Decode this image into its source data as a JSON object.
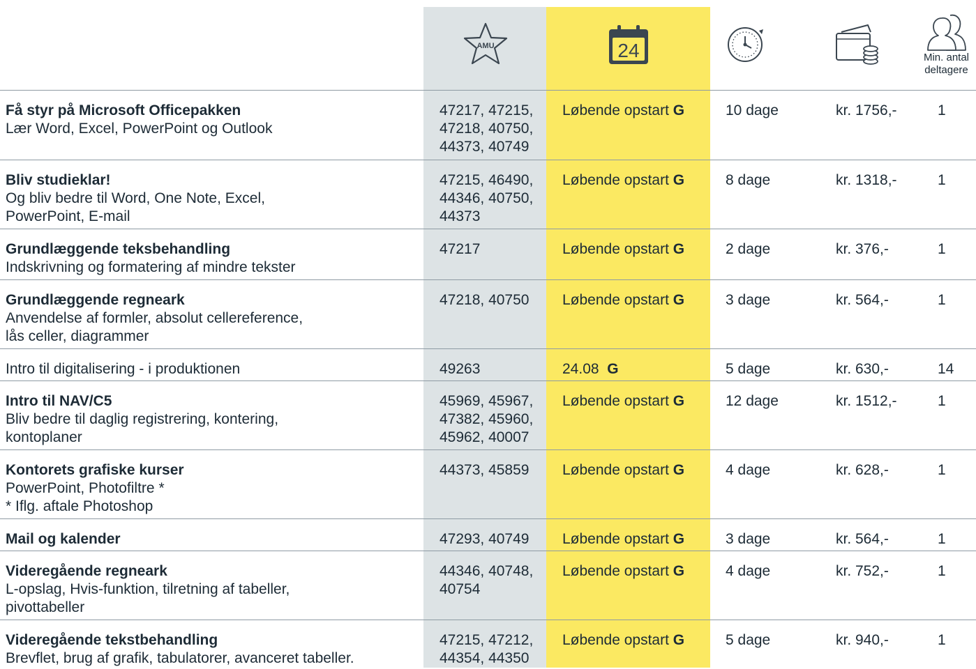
{
  "header": {
    "amu_icon_text": "AMU",
    "calendar_icon_text": "24",
    "min_label_line1": "Min. antal",
    "min_label_line2": "deltagere",
    "icons": [
      "amu-star-icon",
      "calendar-icon",
      "clock-icon",
      "money-icon",
      "people-icon"
    ]
  },
  "colors": {
    "amu_column": "#dde3e5",
    "start_column": "#fbe962",
    "icon": "#3b4650",
    "text": "#1d2b36",
    "divider": "#8e9aa3"
  },
  "rows": [
    {
      "title": "Få styr på Microsoft Officepakken",
      "subtitle_lines": [
        "Lær Word, Excel, PowerPoint og Outlook"
      ],
      "amu_lines": [
        "47217, 47215,",
        "47218, 40750,",
        "44373, 40749"
      ],
      "start": "Løbende opstart",
      "start_flag": "G",
      "duration": "10 dage",
      "price": "kr. 1756,-",
      "min": "1"
    },
    {
      "title": "Bliv studieklar!",
      "subtitle_lines": [
        "Og bliv bedre til Word, One Note, Excel,",
        "PowerPoint, E-mail"
      ],
      "amu_lines": [
        "47215, 46490,",
        "44346, 40750,",
        "44373"
      ],
      "start": "Løbende opstart",
      "start_flag": "G",
      "duration": "8 dage",
      "price": "kr. 1318,-",
      "min": "1"
    },
    {
      "title": "Grundlæggende teksbehandling",
      "subtitle_lines": [
        "Indskrivning og formatering af mindre tekster"
      ],
      "amu_lines": [
        "47217"
      ],
      "start": "Løbende opstart",
      "start_flag": "G",
      "duration": "2 dage",
      "price": "kr. 376,-",
      "min": "1"
    },
    {
      "title": "Grundlæggende regneark",
      "subtitle_lines": [
        "Anvendelse af formler, absolut cellereference,",
        "lås celler, diagrammer"
      ],
      "amu_lines": [
        "47218, 40750"
      ],
      "start": "Løbende opstart",
      "start_flag": "G",
      "duration": "3 dage",
      "price": "kr. 564,-",
      "min": "1"
    },
    {
      "title": "",
      "subtitle_lines": [
        "Intro til digitalisering - i produktionen"
      ],
      "amu_lines": [
        "49263"
      ],
      "start": "24.08 ",
      "start_flag": "G",
      "duration": "5 dage",
      "price": "kr. 630,-",
      "min": "14"
    },
    {
      "title": "Intro til NAV/C5",
      "subtitle_lines": [
        "Bliv bedre til daglig registrering, kontering,",
        "kontoplaner"
      ],
      "amu_lines": [
        "45969, 45967,",
        "47382, 45960,",
        "45962, 40007"
      ],
      "start": "Løbende opstart",
      "start_flag": "G",
      "duration": "12 dage",
      "price": "kr. 1512,-",
      "min": "1"
    },
    {
      "title": "Kontorets grafiske kurser",
      "subtitle_lines": [
        "PowerPoint, Photofiltre *",
        "* Iflg. aftale Photoshop"
      ],
      "amu_lines": [
        "44373, 45859"
      ],
      "start": "Løbende opstart",
      "start_flag": "G",
      "duration": "4 dage",
      "price": "kr. 628,-",
      "min": "1"
    },
    {
      "title": "Mail og kalender",
      "subtitle_lines": [],
      "amu_lines": [
        "47293, 40749"
      ],
      "start": "Løbende opstart",
      "start_flag": "G",
      "duration": "3 dage",
      "price": "kr. 564,-",
      "min": "1"
    },
    {
      "title": "Videregående regneark",
      "subtitle_lines": [
        "L-opslag, Hvis-funktion, tilretning af tabeller,",
        "pivottabeller"
      ],
      "amu_lines": [
        "44346, 40748,",
        "40754"
      ],
      "start": "Løbende opstart",
      "start_flag": "G",
      "duration": "4 dage",
      "price": "kr. 752,-",
      "min": "1"
    },
    {
      "title": "Videregående tekstbehandling",
      "subtitle_lines": [
        "Brevflet, brug af grafik, tabulatorer, avanceret tabeller."
      ],
      "amu_lines": [
        "47215, 47212,",
        "44354, 44350"
      ],
      "start": "Løbende opstart",
      "start_flag": "G",
      "duration": "5 dage",
      "price": "kr. 940,-",
      "min": "1"
    }
  ]
}
